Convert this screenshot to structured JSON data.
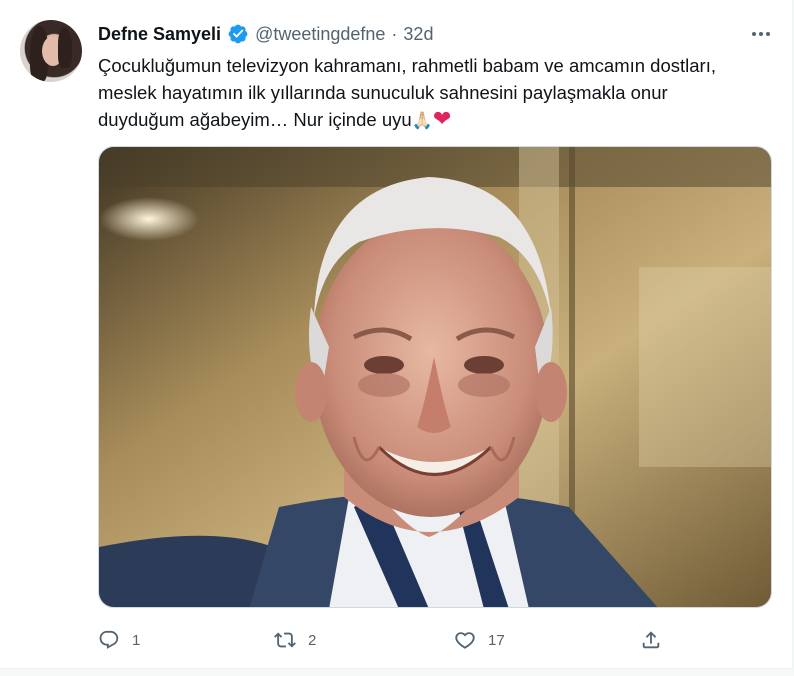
{
  "tweet": {
    "author_name": "Defne Samyeli",
    "handle": "@tweetingdefne",
    "separator": "·",
    "time": "32d",
    "text_lines": [
      "Çocukluğumun televizyon kahramanı, rahmetli babam ve amcamın dostları,",
      "meslek hayatımın ilk yıllarında sunuculuk sahnesini paylaşmakla onur",
      "duyduğum ağabeyim… Nur içinde uyu"
    ],
    "emoji_pray": "🙏🏻",
    "emoji_heart": "❤",
    "icons": {
      "verified": "verified-badge-icon",
      "more": "more-dots-icon",
      "reply": "reply-icon",
      "retweet": "retweet-icon",
      "like": "heart-icon",
      "share": "share-icon"
    },
    "colors": {
      "verified": "#1d9bf0",
      "text": "#0f1419",
      "secondary": "#536471",
      "heart_emoji": "#e0245e"
    }
  },
  "actions": {
    "reply_count": "1",
    "retweet_count": "2",
    "like_count": "17",
    "share_count": ""
  }
}
